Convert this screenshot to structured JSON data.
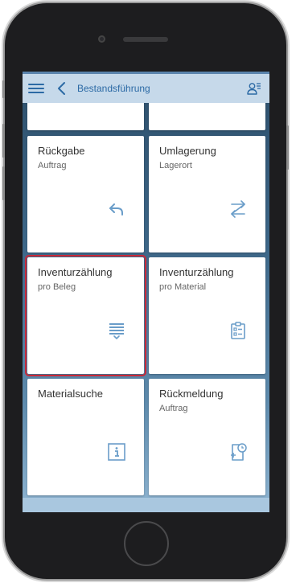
{
  "shell": {
    "title": "Bestandsführung",
    "icons": {
      "menu": "hamburger-menu-icon",
      "back": "back-chevron-icon",
      "user": "user-settings-icon"
    }
  },
  "tiles": [
    {
      "title": "",
      "subtitle": "",
      "icon": ""
    },
    {
      "title": "",
      "subtitle": "",
      "icon": ""
    },
    {
      "title": "Rückgabe",
      "subtitle": "Auftrag",
      "icon": "return-arrow-icon"
    },
    {
      "title": "Umlagerung",
      "subtitle": "Lagerort",
      "icon": "transfer-arrows-icon"
    },
    {
      "title": "Inventurzählung",
      "subtitle": "pro Beleg",
      "icon": "list-collapse-icon",
      "selected": true
    },
    {
      "title": "Inventurzählung",
      "subtitle": "pro Material",
      "icon": "clipboard-checklist-icon"
    },
    {
      "title": "Materialsuche",
      "subtitle": "",
      "icon": "info-icon"
    },
    {
      "title": "Rückmeldung",
      "subtitle": "Auftrag",
      "icon": "document-add-clock-icon"
    }
  ],
  "colors": {
    "accent": "#2c6aa5",
    "shell_bg": "#c6d9ea",
    "icon": "#6a9dc9",
    "selection": "#c8293a"
  }
}
